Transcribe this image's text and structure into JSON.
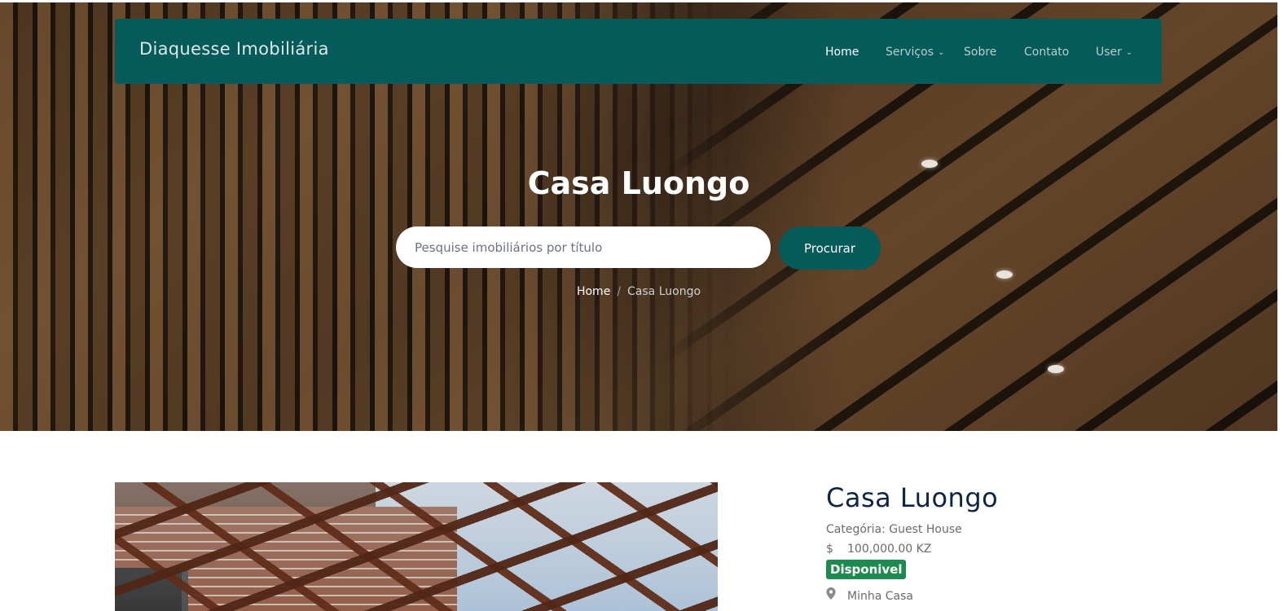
{
  "navbar": {
    "brand": "Diaquesse Imobiliária",
    "items": [
      {
        "label": "Home",
        "active": true,
        "dropdown": false
      },
      {
        "label": "Serviços",
        "active": false,
        "dropdown": true
      },
      {
        "label": "Sobre",
        "active": false,
        "dropdown": false
      },
      {
        "label": "Contato",
        "active": false,
        "dropdown": false
      },
      {
        "label": "User",
        "active": false,
        "dropdown": true
      }
    ],
    "background_color": "#055a5a"
  },
  "hero": {
    "title": "Casa Luongo",
    "search": {
      "placeholder": "Pesquise imobiliários por título",
      "value": "",
      "button_label": "Procurar"
    },
    "breadcrumb": {
      "home": "Home",
      "separator": "/",
      "current": "Casa Luongo"
    }
  },
  "property": {
    "title": "Casa Luongo",
    "category": "Categória: Guest House",
    "currency_icon": "$",
    "price": "100,000.00 KZ",
    "status": "Disponivel",
    "status_color": "#1d8a4f",
    "location": "Minha Casa",
    "location_icon": "map-pin-icon"
  }
}
